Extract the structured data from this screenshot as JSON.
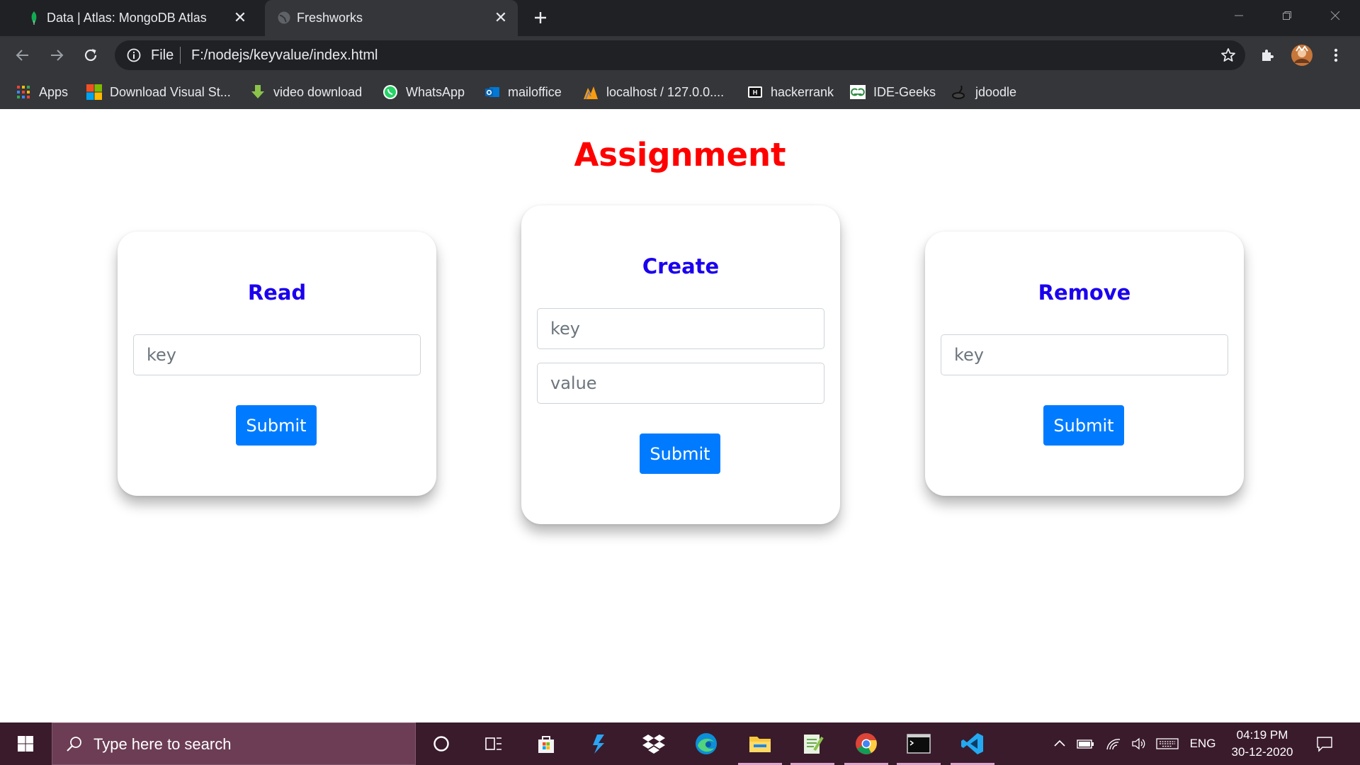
{
  "browser": {
    "tabs": [
      {
        "title": "Data | Atlas: MongoDB Atlas",
        "icon": "mongodb-leaf-icon",
        "active": false
      },
      {
        "title": "Freshworks",
        "icon": "globe-icon",
        "active": true
      }
    ],
    "address": {
      "scheme_label": "File",
      "url": "F:/nodejs/keyvalue/index.html"
    },
    "bookmarks": [
      {
        "label": "Apps",
        "icon": "apps-grid-icon"
      },
      {
        "label": "Download Visual St...",
        "icon": "windows-logo-icon"
      },
      {
        "label": "video download",
        "icon": "download-arrow-icon"
      },
      {
        "label": "WhatsApp",
        "icon": "whatsapp-icon"
      },
      {
        "label": "mailoffice",
        "icon": "outlook-icon"
      },
      {
        "label": "localhost / 127.0.0....",
        "icon": "phpmyadmin-icon"
      },
      {
        "label": "hackerrank",
        "icon": "hackerrank-icon"
      },
      {
        "label": "IDE-Geeks",
        "icon": "geeksforgeeks-icon"
      },
      {
        "label": "jdoodle",
        "icon": "jdoodle-icon"
      }
    ]
  },
  "page": {
    "title": "Assignment",
    "cards": {
      "read": {
        "title": "Read",
        "key_placeholder": "key",
        "submit_label": "Submit"
      },
      "create": {
        "title": "Create",
        "key_placeholder": "key",
        "value_placeholder": "value",
        "submit_label": "Submit"
      },
      "remove": {
        "title": "Remove",
        "key_placeholder": "key",
        "submit_label": "Submit"
      }
    }
  },
  "taskbar": {
    "search_placeholder": "Type here to search",
    "apps": [
      "cortana-icon",
      "task-view-icon",
      "store-icon",
      "azure-studio-icon",
      "dropbox-icon",
      "edge-icon",
      "file-explorer-icon",
      "notepad-plus-icon",
      "chrome-icon",
      "terminal-icon",
      "vscode-icon"
    ],
    "language": "ENG",
    "time": "04:19 PM",
    "date": "30-12-2020"
  },
  "colors": {
    "page_title": "#ff0000",
    "card_title": "#1a00ee",
    "button": "#007bff"
  }
}
